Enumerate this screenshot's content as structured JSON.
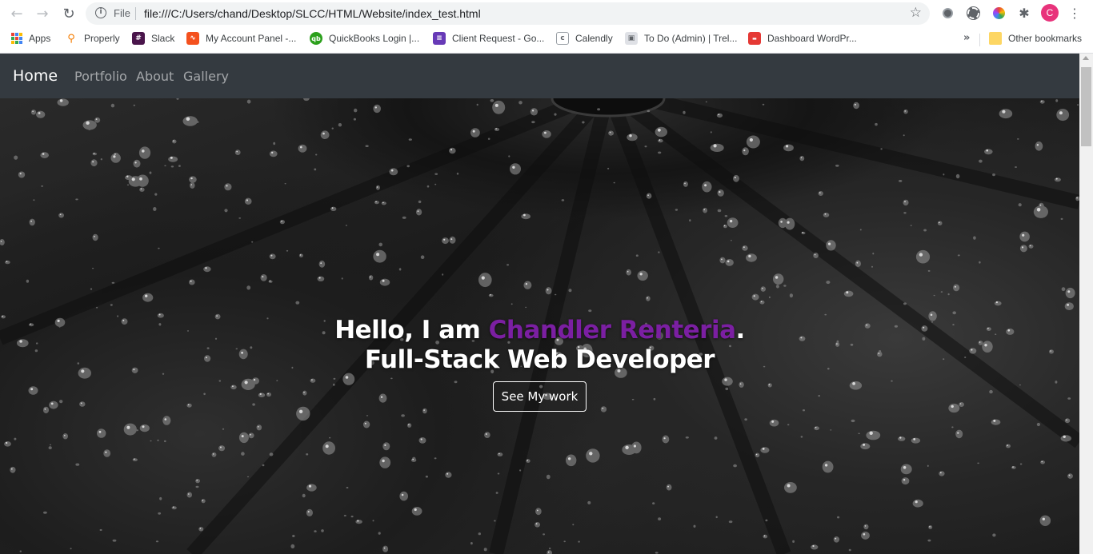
{
  "browser": {
    "address_scheme": "File",
    "url": "file:///C:/Users/chand/Desktop/SLCC/HTML/Website/index_test.html",
    "profile_initial": "C",
    "bookmarks": [
      {
        "label": "Apps",
        "icon": "apps-icon"
      },
      {
        "label": "Properly",
        "icon": "properly-icon"
      },
      {
        "label": "Slack",
        "icon": "slack-icon"
      },
      {
        "label": "My Account Panel -...",
        "icon": "account-panel-icon"
      },
      {
        "label": "QuickBooks Login |...",
        "icon": "quickbooks-icon"
      },
      {
        "label": "Client Request - Go...",
        "icon": "google-forms-icon"
      },
      {
        "label": "Calendly",
        "icon": "calendly-icon"
      },
      {
        "label": "To Do (Admin) | Trel...",
        "icon": "trello-icon"
      },
      {
        "label": "Dashboard WordPr...",
        "icon": "wordpress-icon"
      }
    ],
    "other_bookmarks": "Other bookmarks",
    "colors": {
      "profile": "#e8337b",
      "toolbar_bg": "#ffffff",
      "omnibox_bg": "#f1f3f4"
    }
  },
  "site": {
    "nav": {
      "brand": "Home",
      "links": [
        "Portfolio",
        "About",
        "Gallery"
      ]
    },
    "hero": {
      "greeting_prefix": "Hello, I am ",
      "name": "Chandler Renteria",
      "greeting_suffix": ".",
      "subtitle": "Full-Stack Web Developer",
      "button_label": "See My work"
    },
    "colors": {
      "navbar_bg": "#343a40",
      "name_accent": "#7b1fa2"
    }
  }
}
